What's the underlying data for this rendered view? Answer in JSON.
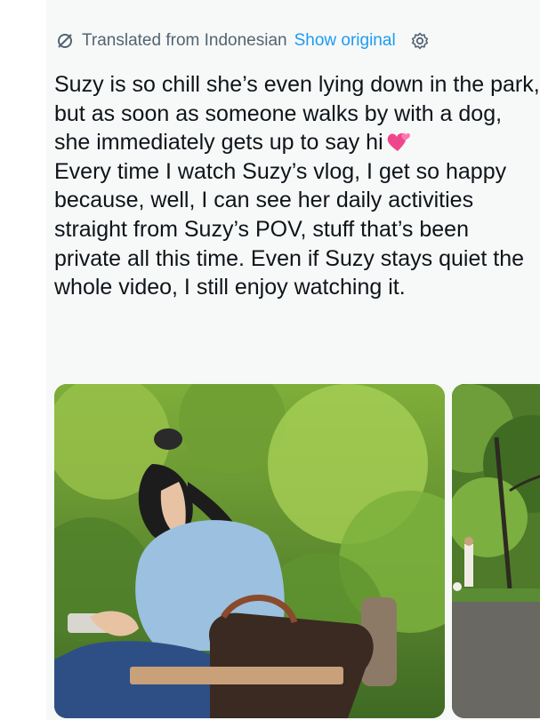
{
  "translation": {
    "label": "Translated from Indonesian",
    "show_original": "Show original"
  },
  "tweet": {
    "text_main": "Suzy is so chill she’s even lying down in the park, but as soon as someone walks by with a dog, she immediately gets up to say hi",
    "text_rest": "Every time I watch Suzy’s vlog, I get so happy because, well, I can see her daily activities straight from Suzy’s POV, stuff that’s been private all this time. Even if Suzy stays quiet the whole video, I still enjoy watching it."
  },
  "icons": {
    "translate": "translate-icon",
    "settings": "gear-icon",
    "emoji": "two-hearts-emoji"
  },
  "colors": {
    "link": "#1d9bf0",
    "muted": "#536471",
    "text": "#0f1419"
  }
}
